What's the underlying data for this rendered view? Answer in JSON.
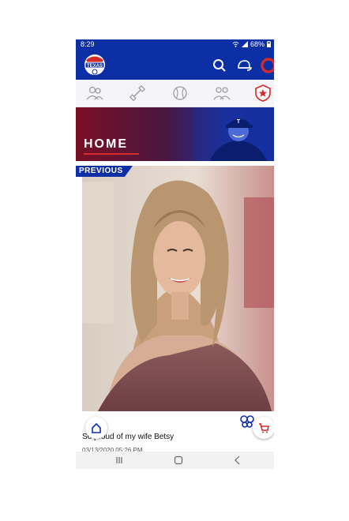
{
  "status_bar": {
    "time": "8:29",
    "battery": "68%",
    "icons": [
      "wifi-icon",
      "signal-icon",
      "battery-icon"
    ]
  },
  "app_bar": {
    "logo": "Texas team logo",
    "actions": [
      {
        "name": "search-icon"
      },
      {
        "name": "cap-icon"
      },
      {
        "name": "ring-icon"
      }
    ]
  },
  "categories": [
    {
      "name": "people-icon"
    },
    {
      "name": "dumbbell-icon"
    },
    {
      "name": "baseball-icon"
    },
    {
      "name": "group-icon"
    },
    {
      "name": "shield-star-icon"
    }
  ],
  "hero": {
    "title": "HOME"
  },
  "post": {
    "tag": "PREVIOUS",
    "caption": "So proud of my wife Betsy",
    "date": "03/13/2020 05:26 PM"
  },
  "colors": {
    "primary": "#0d2fa6",
    "accent": "#d32b2b"
  },
  "nav_bar": {
    "buttons": [
      "recents-icon",
      "home-nav-icon",
      "back-icon"
    ]
  }
}
